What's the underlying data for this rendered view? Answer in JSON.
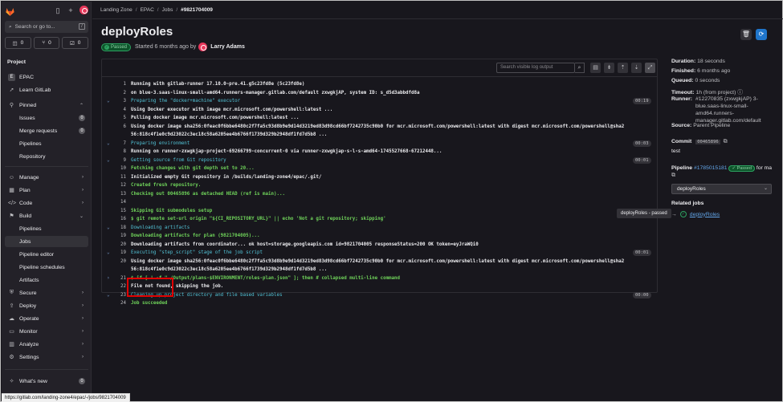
{
  "sidebar": {
    "search_placeholder": "Search or go to...",
    "search_kbd": "/",
    "counters": [
      {
        "label": "0",
        "icon": "issues-icon"
      },
      {
        "label": "0",
        "icon": "merge-request-icon"
      },
      {
        "label": "0",
        "icon": "todo-icon"
      }
    ],
    "section_project": "Project",
    "project_badge": "E",
    "project_name": "EPAC",
    "learn": "Learn GitLab",
    "pinned": "Pinned",
    "pinned_items": [
      {
        "label": "Issues",
        "badge": "0"
      },
      {
        "label": "Merge requests",
        "badge": "0"
      },
      {
        "label": "Pipelines"
      },
      {
        "label": "Repository"
      }
    ],
    "groups": [
      {
        "label": "Manage"
      },
      {
        "label": "Plan"
      },
      {
        "label": "Code"
      },
      {
        "label": "Build"
      }
    ],
    "build_items": [
      "Pipelines",
      "Jobs",
      "Pipeline editor",
      "Pipeline schedules",
      "Artifacts"
    ],
    "groups2": [
      {
        "label": "Secure"
      },
      {
        "label": "Deploy"
      },
      {
        "label": "Operate"
      },
      {
        "label": "Monitor"
      },
      {
        "label": "Analyze"
      },
      {
        "label": "Settings"
      }
    ],
    "whats_new": "What's new",
    "whats_new_badge": "0"
  },
  "breadcrumb": [
    "Landing Zone",
    "EPAC",
    "Jobs",
    "#9821704009"
  ],
  "job": {
    "title": "deployRoles",
    "status": "Passed",
    "started": "Started 6 months ago by",
    "author": "Larry Adams"
  },
  "log": {
    "search_placeholder": "Search visible log output",
    "lines": [
      {
        "n": "1",
        "t": "Running with gitlab-runner 17.10.0~pre.41.g5c23fd8e (5c23fd8e)",
        "c": "w"
      },
      {
        "n": "2",
        "t": "  on blue-3.saas-linux-small-amd64.runners-manager.gitlab.com/default zxwgkjAP, system ID: s_d5d3abbdfd8a",
        "c": "w"
      },
      {
        "n": "3",
        "t": "Preparing the \"docker+machine\" executor",
        "c": "c",
        "tg": "v",
        "d": "00:19"
      },
      {
        "n": "4",
        "t": "Using Docker executor with image mcr.microsoft.com/powershell:latest ...",
        "c": "w"
      },
      {
        "n": "5",
        "t": "Pulling docker image mcr.microsoft.com/powershell:latest ...",
        "c": "w"
      },
      {
        "n": "6",
        "t": "Using docker image sha256:0feac0f6bbe6480c2f7fa5c93d8b9e9d14d3219ed83d98cd66bf7242735c90b0 for mcr.microsoft.com/powershell:latest with digest mcr.microsoft.com/powershell@sha2",
        "c": "w"
      },
      {
        "n": "",
        "t": "56:818c4f1e0c9d23022c3ec18c58a6205ee4b6766f1739d329b2948df1fd7d5b8 ...",
        "c": "w"
      },
      {
        "n": "7",
        "t": "Preparing environment",
        "c": "c",
        "tg": "v",
        "d": "00:03"
      },
      {
        "n": "8",
        "t": "Running on runner-zxwgkjap-project-69266799-concurrent-0 via runner-zxwgkjap-s-l-s-amd64-1745527668-67212448...",
        "c": "w"
      },
      {
        "n": "9",
        "t": "Getting source from Git repository",
        "c": "c",
        "tg": "v",
        "d": "00:01"
      },
      {
        "n": "10",
        "t": "Fetching changes with git depth set to 20...",
        "c": "g"
      },
      {
        "n": "11",
        "t": "Initialized empty Git repository in /builds/landing-zone4/epac/.git/",
        "c": "w"
      },
      {
        "n": "12",
        "t": "Created fresh repository.",
        "c": "g"
      },
      {
        "n": "13",
        "t": "Checking out 00465896 as detached HEAD (ref is main)...",
        "c": "g"
      },
      {
        "n": "14",
        "t": "",
        "c": "w"
      },
      {
        "n": "15",
        "t": "Skipping Git submodules setup",
        "c": "g"
      },
      {
        "n": "16",
        "t": "$ git remote set-url origin \"${CI_REPOSITORY_URL}\" || echo 'Not a git repository; skipping'",
        "c": "g"
      },
      {
        "n": "18",
        "t": "Downloading artifacts",
        "c": "c",
        "tg": "v"
      },
      {
        "n": "19",
        "t": "Downloading artifacts for plan (9821704005)...",
        "c": "g"
      },
      {
        "n": "20",
        "t": "Downloading artifacts from coordinator... ok        host=storage.googleapis.com id=9821704005 responseStatus=200 OK token=eyJraWQi0",
        "c": "w"
      },
      {
        "n": "19",
        "t": "Executing \"step_script\" stage of the job script",
        "c": "c",
        "tg": "v",
        "d": "00:01"
      },
      {
        "n": "20",
        "t": "Using docker image sha256:0feac0f6bbe6480c2f7fa5c93d8b9e9d14d3219ed83d98cd66bf7242735c90b0 for mcr.microsoft.com/powershell:latest with digest mcr.microsoft.com/powershell@sha2",
        "c": "w"
      },
      {
        "n": "",
        "t": "56:818c4f1e0c9d23022c3ec18c58a6205ee4b6766f1739d329b2948df1fd7d5b8 ...",
        "c": "w"
      },
      {
        "n": "21",
        "t": "$ if [ ! -f \"./Output/plans-$ENVIRONMENT/roles-plan.json\" ]; then # collapsed multi-line command",
        "c": "g",
        "tg": ">"
      },
      {
        "n": "22",
        "t": "File not found, skipping the job.",
        "c": "w"
      },
      {
        "n": "23",
        "t": "Cleaning up project directory and file based variables",
        "c": "c",
        "tg": "v",
        "d": "00:00"
      },
      {
        "n": "24",
        "t": "Job succeeded",
        "c": "g"
      }
    ]
  },
  "details": {
    "duration_k": "Duration:",
    "duration_v": "18 seconds",
    "finished_k": "Finished:",
    "finished_v": "6 months ago",
    "queued_k": "Queued:",
    "queued_v": "0 seconds",
    "timeout_k": "Timeout:",
    "timeout_v": "1h (from project)",
    "runner_k": "Runner:",
    "runner_v1": "#12270835 (zxwgkjAP) 3-",
    "runner_v2": "blue.saas-linux-small-",
    "runner_v3": "amd64.runners-",
    "runner_v4": "manager.gitlab.com/default",
    "source_k": "Source:",
    "source_v": "Parent Pipeline",
    "commit_k": "Commit",
    "commit_v": "00465896",
    "commit_msg": "test",
    "pipeline_k": "Pipeline",
    "pipeline_v": "#1785015181",
    "pipeline_status": "Passed",
    "pipeline_tail": "for ma",
    "stage_select": "deployRoles",
    "related_k": "Related jobs",
    "related_job": "deployRoles",
    "tooltip": "deployRoles - passed"
  },
  "statusbar": "https://gitlab.com/landing-zone4/epac/-/jobs/9821704009",
  "colors": {
    "accent": "#63a6e9",
    "success": "#2da160",
    "brand": "#fc6d26",
    "highlight": "#e10000"
  }
}
